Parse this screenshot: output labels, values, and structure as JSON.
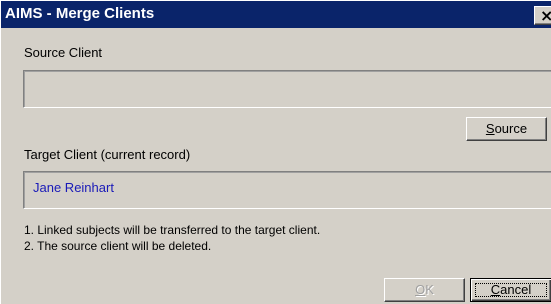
{
  "window": {
    "title": "AIMS - Merge Clients",
    "close_glyph": "×"
  },
  "source": {
    "label": "Source Client",
    "value": "",
    "button_label": "Source"
  },
  "target": {
    "label": "Target Client (current record)",
    "value": "Jane Reinhart"
  },
  "notes": [
    "1. Linked subjects will be transferred to the target client.",
    "2. The source client will be deleted."
  ],
  "buttons": {
    "ok_label": "OK",
    "ok_enabled": false,
    "cancel_label": "Cancel"
  },
  "colors": {
    "title_bar": "#0a246a",
    "dialog_face": "#d4d0c8",
    "target_value_text": "#1a1ab8"
  },
  "icons": {
    "close": "close-icon"
  }
}
